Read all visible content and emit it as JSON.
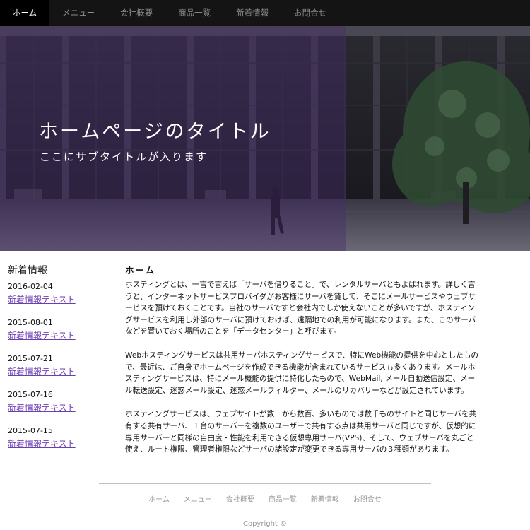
{
  "nav": {
    "items": [
      {
        "label": "ホーム",
        "active": true
      },
      {
        "label": "メニュー"
      },
      {
        "label": "会社概要"
      },
      {
        "label": "商品一覧"
      },
      {
        "label": "新着情報"
      },
      {
        "label": "お問合せ"
      }
    ]
  },
  "hero": {
    "title": "ホームページのタイトル",
    "subtitle": "ここにサブタイトルが入ります",
    "overlay_color": "#482d6e"
  },
  "sidebar": {
    "heading": "新着情報",
    "news": [
      {
        "date": "2016-02-04",
        "text": "新着情報テキスト"
      },
      {
        "date": "2015-08-01",
        "text": "新着情報テキスト"
      },
      {
        "date": "2015-07-21",
        "text": "新着情報テキスト"
      },
      {
        "date": "2015-07-16",
        "text": "新着情報テキスト"
      },
      {
        "date": "2015-07-15",
        "text": "新着情報テキスト"
      }
    ]
  },
  "main": {
    "heading": "ホーム",
    "paragraphs": [
      "ホスティングとは、一言で言えば「サーバを借りること」で、レンタルサーバともよばれます。詳しく言うと、インターネットサービスプロバイダがお客様にサーバを貸して、そこにメールサービスやウェブサービスを預けておくことです。自社のサーバですと会社内でしか使えないことが多いですが、ホスティングサービスを利用し外部のサーバに預けておけば、遠隔地での利用が可能になります。また、このサーバなどを置いておく場所のことを「データセンター」と呼びます。",
      "Webホスティングサービスは共用サーバホスティングサービスで、特にWeb機能の提供を中心としたもので、最近は、ご自身でホームページを作成できる機能が含まれているサービスも多くあります。メールホスティングサービスは、特にメール機能の提供に特化したもので、WebMail, メール自動送信設定、メール転送設定、迷惑メール設定、迷惑メールフィルター、メールのリカバリーなどが設定されています。",
      "ホスティングサービスは、ウェブサイトが数十から数百、多いものでは数千ものサイトと同じサーバを共有する共有サーバ、１台のサーバーを複数のユーザーで共有する点は共用サーバと同じですが、仮想的に専用サーバーと同様の自由度・性能を利用できる仮想専用サーバ(VPS)、そして、ウェブサーバを丸ごと使え、ルート権限、管理者権限などサーバの諸設定が変更できる専用サーバの３種類があります。"
    ]
  },
  "footer": {
    "links": [
      "ホーム",
      "メニュー",
      "会社概要",
      "商品一覧",
      "新着情報",
      "お問合せ"
    ],
    "copyright": "Copyright ©"
  }
}
